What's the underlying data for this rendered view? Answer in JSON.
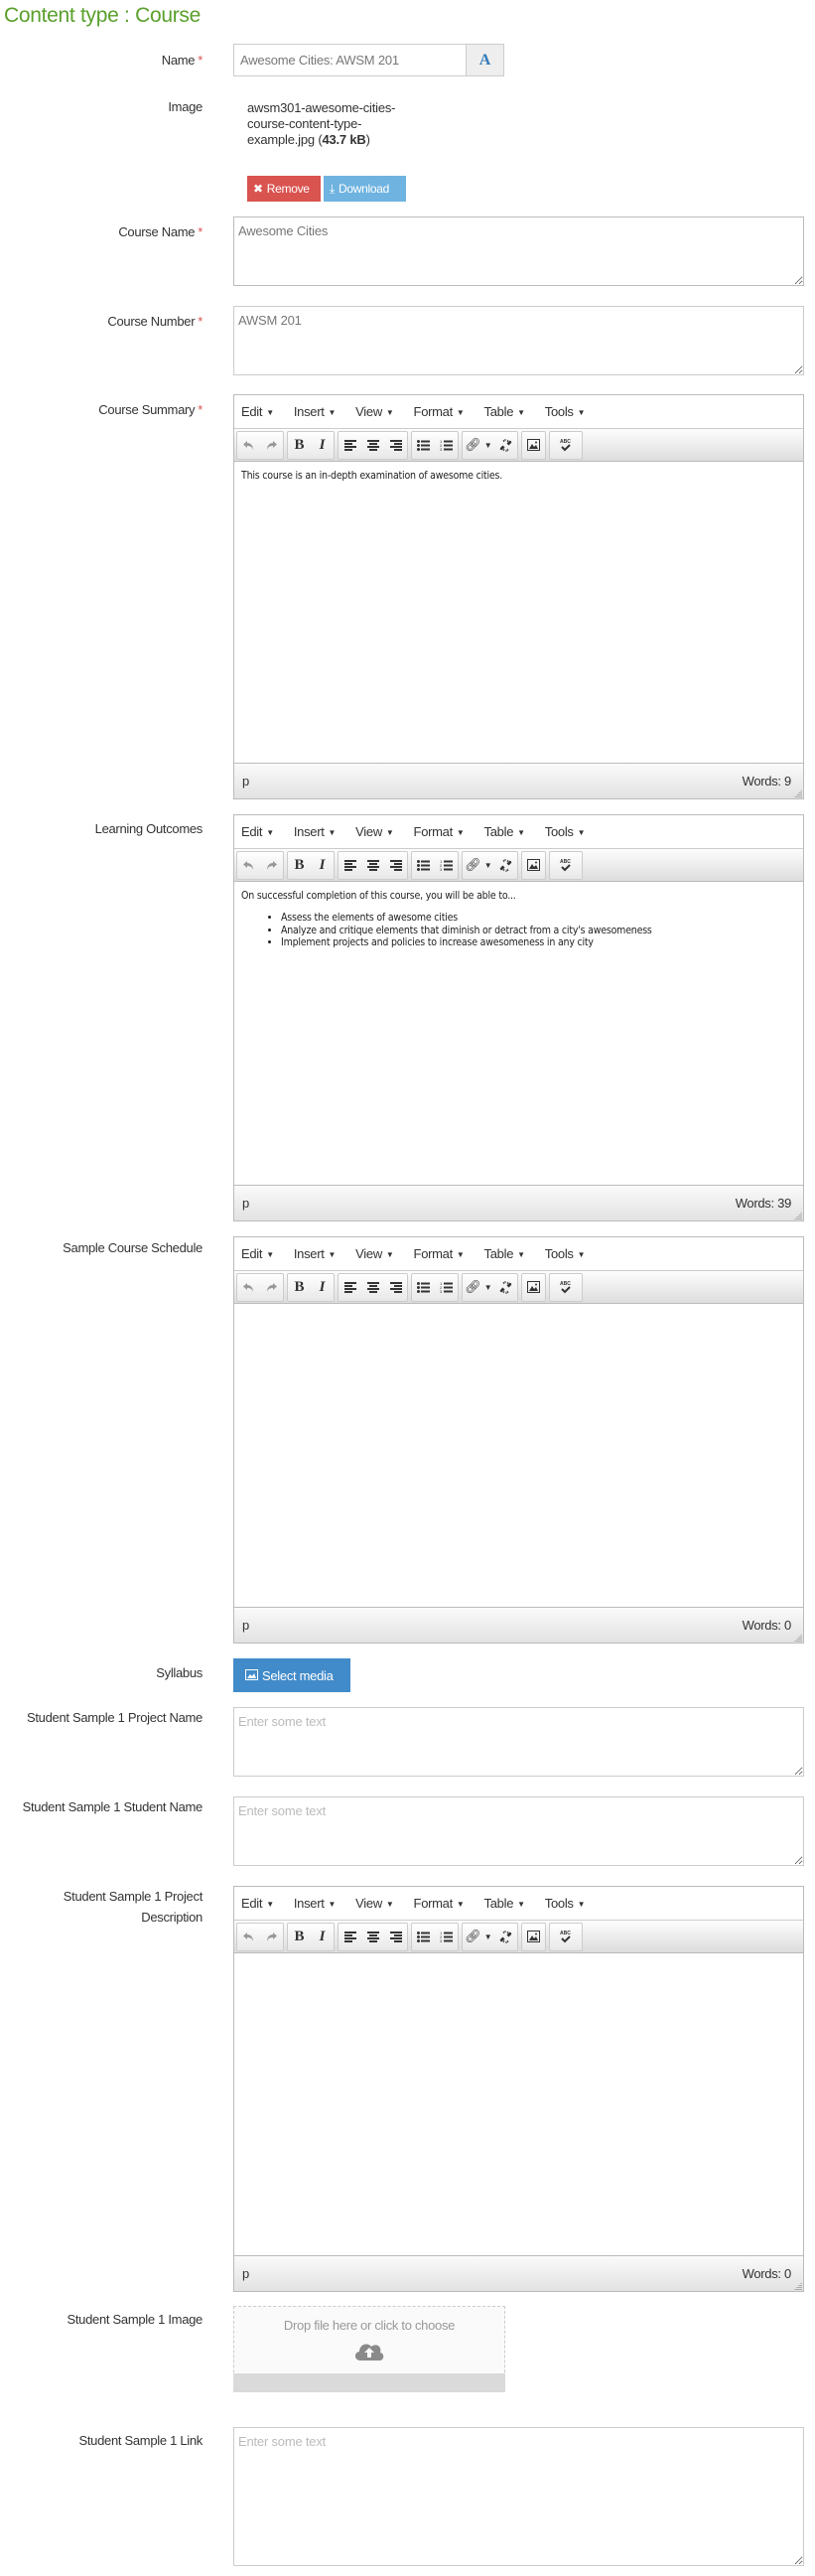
{
  "page": {
    "title": "Content type : Course"
  },
  "fields": {
    "name": {
      "label": "Name",
      "required": true,
      "value": "Awesome Cities: AWSM 201",
      "addon_label": "A"
    },
    "image": {
      "label": "Image",
      "filename": "awsm301-awesome-cities-course-content-type-example.jpg",
      "filesize": "43.7 kB",
      "remove_label": "Remove",
      "download_label": "Download"
    },
    "course_name": {
      "label": "Course Name",
      "required": true,
      "value": "Awesome Cities"
    },
    "course_number": {
      "label": "Course Number",
      "required": true,
      "value": "AWSM 201"
    },
    "course_summary": {
      "label": "Course Summary",
      "required": true,
      "content_paragraph": "This course is an in-depth examination of awesome cities.",
      "path": "p",
      "word_count": "Words: 9"
    },
    "learning_outcomes": {
      "label": "Learning Outcomes",
      "content_paragraph": "On successful completion of this course, you will be able to...",
      "content_list": [
        "Assess the elements of awesome cities",
        "Analyze and critique elements that diminish or detract from a city's awesomeness",
        "Implement projects and policies to increase awesomeness in any city"
      ],
      "path": "p",
      "word_count": "Words: 39"
    },
    "sample_course_schedule": {
      "label": "Sample Course Schedule",
      "path": "p",
      "word_count": "Words: 0"
    },
    "syllabus": {
      "label": "Syllabus",
      "button_label": "Select media"
    },
    "student_project_name": {
      "label": "Student Sample 1 Project Name",
      "placeholder": "Enter some text",
      "value": ""
    },
    "student_name": {
      "label": "Student Sample 1 Student Name",
      "placeholder": "Enter some text",
      "value": ""
    },
    "student_project_description": {
      "label": "Student Sample 1 Project Description",
      "path": "p",
      "word_count": "Words: 0"
    },
    "student_image": {
      "label": "Student Sample 1 Image",
      "dropzone_text": "Drop file here or click to choose"
    },
    "student_link": {
      "label": "Student Sample 1 Link",
      "placeholder": "Enter some text",
      "value": ""
    }
  },
  "editor": {
    "menu": [
      "Edit",
      "Insert",
      "View",
      "Format",
      "Table",
      "Tools"
    ],
    "toolbar": [
      "undo",
      "redo",
      "bold",
      "italic",
      "align-left",
      "align-center",
      "align-right",
      "bullet-list",
      "numbered-list",
      "link",
      "unlink",
      "image",
      "spellcheck"
    ]
  },
  "colors": {
    "title": "#5aa02c",
    "required": "#d9534f",
    "remove": "#d9534f",
    "download": "#6fb3e0",
    "select_media": "#428bca"
  }
}
